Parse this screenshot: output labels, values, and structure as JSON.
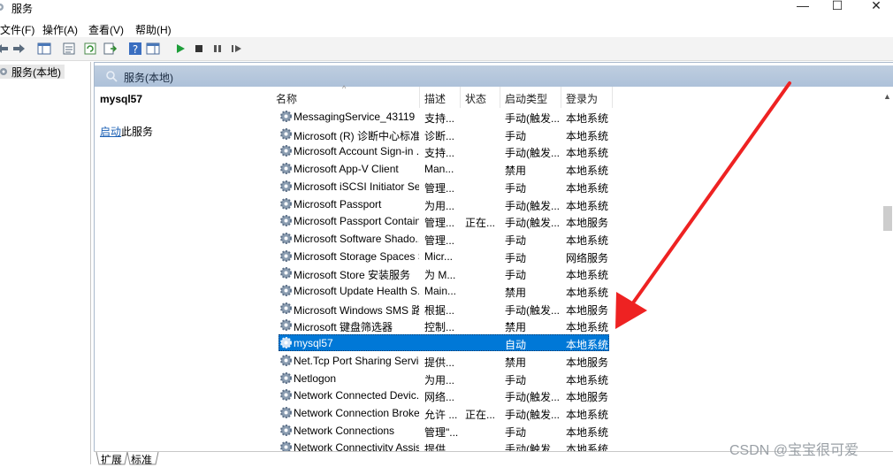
{
  "window": {
    "title": "服务",
    "minimize": "—",
    "maximize": "☐",
    "close": "✕"
  },
  "menu": [
    "文件(F)",
    "操作(A)",
    "查看(V)",
    "帮助(H)"
  ],
  "toolbar": {
    "icons": [
      "back-arrow-icon",
      "forward-arrow-icon",
      "show-console-tree-icon",
      "properties-icon",
      "refresh-icon",
      "export-list-icon",
      "help-icon",
      "show-hide-action-pane-icon",
      "start-service-icon",
      "stop-service-icon",
      "pause-service-icon",
      "restart-service-icon"
    ]
  },
  "tree": {
    "item": "服务(本地)"
  },
  "main": {
    "header": "服务(本地)"
  },
  "description": {
    "service_name": "mysql57",
    "start_link": "启动",
    "start_suffix": "此服务"
  },
  "columns": {
    "name": "名称",
    "desc": "描述",
    "status": "状态",
    "startup": "启动类型",
    "logon": "登录为"
  },
  "rows": [
    {
      "name": "MessagingService_43119",
      "desc": "支持...",
      "status": "",
      "startup": "手动(触发...",
      "logon": "本地系统"
    },
    {
      "name": "Microsoft (R) 诊断中心标准...",
      "desc": "诊断...",
      "status": "",
      "startup": "手动",
      "logon": "本地系统"
    },
    {
      "name": "Microsoft Account Sign-in ...",
      "desc": "支持...",
      "status": "",
      "startup": "手动(触发...",
      "logon": "本地系统"
    },
    {
      "name": "Microsoft App-V Client",
      "desc": "Man...",
      "status": "",
      "startup": "禁用",
      "logon": "本地系统"
    },
    {
      "name": "Microsoft iSCSI Initiator Ser...",
      "desc": "管理...",
      "status": "",
      "startup": "手动",
      "logon": "本地系统"
    },
    {
      "name": "Microsoft Passport",
      "desc": "为用...",
      "status": "",
      "startup": "手动(触发...",
      "logon": "本地系统"
    },
    {
      "name": "Microsoft Passport Container",
      "desc": "管理...",
      "status": "正在...",
      "startup": "手动(触发...",
      "logon": "本地服务"
    },
    {
      "name": "Microsoft Software Shado...",
      "desc": "管理...",
      "status": "",
      "startup": "手动",
      "logon": "本地系统"
    },
    {
      "name": "Microsoft Storage Spaces S...",
      "desc": "Micr...",
      "status": "",
      "startup": "手动",
      "logon": "网络服务"
    },
    {
      "name": "Microsoft Store 安装服务",
      "desc": "为 M...",
      "status": "",
      "startup": "手动",
      "logon": "本地系统"
    },
    {
      "name": "Microsoft Update Health S...",
      "desc": "Main...",
      "status": "",
      "startup": "禁用",
      "logon": "本地系统"
    },
    {
      "name": "Microsoft Windows SMS 路...",
      "desc": "根据...",
      "status": "",
      "startup": "手动(触发...",
      "logon": "本地服务"
    },
    {
      "name": "Microsoft 键盘筛选器",
      "desc": "控制...",
      "status": "",
      "startup": "禁用",
      "logon": "本地系统"
    },
    {
      "name": "mysql57",
      "desc": "",
      "status": "",
      "startup": "自动",
      "logon": "本地系统",
      "selected": true
    },
    {
      "name": "Net.Tcp Port Sharing Service",
      "desc": "提供...",
      "status": "",
      "startup": "禁用",
      "logon": "本地服务"
    },
    {
      "name": "Netlogon",
      "desc": "为用...",
      "status": "",
      "startup": "手动",
      "logon": "本地系统"
    },
    {
      "name": "Network Connected Devic...",
      "desc": "网络...",
      "status": "",
      "startup": "手动(触发...",
      "logon": "本地服务"
    },
    {
      "name": "Network Connection Broker",
      "desc": "允许 ...",
      "status": "正在...",
      "startup": "手动(触发...",
      "logon": "本地系统"
    },
    {
      "name": "Network Connections",
      "desc": "管理\"...",
      "status": "",
      "startup": "手动",
      "logon": "本地系统"
    },
    {
      "name": "Network Connectivity Assis...",
      "desc": "提供...",
      "status": "",
      "startup": "手动(触发...",
      "logon": "本地系统"
    }
  ],
  "tabs": [
    "扩展",
    "标准"
  ],
  "watermark": "CSDN @宝宝很可爱",
  "colors": {
    "selection": "#0078d7",
    "header_bar": "#b6c7dd",
    "annotation_arrow": "#ee2222"
  }
}
